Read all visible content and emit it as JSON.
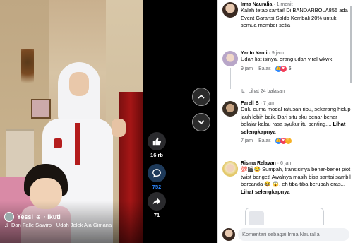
{
  "video": {
    "author": "Yessi",
    "follow_label": "· Ikuti",
    "music_text": "Dan Falle Sawiro · Udah Jelek Aja Gimana"
  },
  "actions": {
    "likes": "16 rb",
    "comments": "752",
    "shares": "71"
  },
  "comments": [
    {
      "name": "Irma Nauralia",
      "time": "· 1 menit",
      "text": "Kalah tetap santai! Di BANDARBOLA855 ada Event Garansi Saldo Kembali 20% untuk semua member setia"
    },
    {
      "name": "Yanto Yanti",
      "time": "· 9 jam",
      "text": "Udah liat isinya, orang udah viral wkwk",
      "time_short": "9 jam",
      "reply_label": "Balas",
      "reaction_count": "5",
      "replies_label": "Lihat 24 balasan"
    },
    {
      "name": "Farell B",
      "time": "· 7 jam",
      "text": "Dulu cuma modal ratusan ribu, sekarang hidup jauh lebih baik. Dari situ aku benar-benar belajar kalau rasa syukur itu penting.... ",
      "more_label": "Lihat selengkapnya",
      "time_short": "7 jam",
      "reply_label": "Balas"
    },
    {
      "name": "Risma Relavan",
      "time": "· 6 jam",
      "emoji_prefix": "💯🎬😂",
      "text": " Sumpah, transisinya bener-bener piot twist banget! Awalnya masih bisa santai sambil bercanda 😂 ",
      "text2": "😱, eh tiba-tiba berubah dras...",
      "more_label": "Lihat selengkapnya"
    }
  ],
  "composer": {
    "placeholder": "Komentari sebagai Irma Nauralia"
  }
}
